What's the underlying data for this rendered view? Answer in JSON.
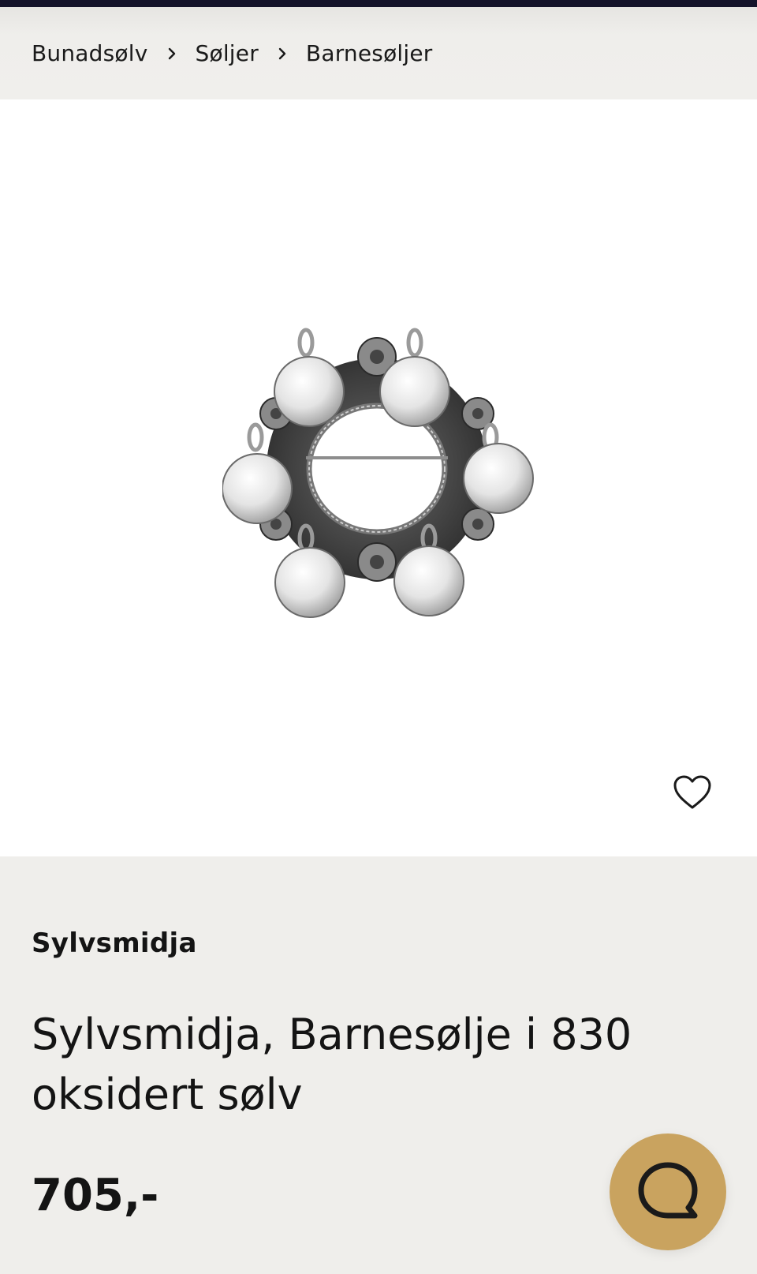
{
  "breadcrumb": {
    "items": [
      {
        "label": "Bunadsølv"
      },
      {
        "label": "Søljer"
      },
      {
        "label": "Barnesøljer"
      }
    ],
    "separator_icon": "chevron-right-icon"
  },
  "product": {
    "image_icon": "brooch-product-image",
    "favorite_icon": "heart-outline-icon",
    "brand": "Sylvsmidja",
    "title_line1": "Sylvsmidja, Barnesølje i 830",
    "title_line2": "oksidert sølv",
    "price": "705,-"
  },
  "chat": {
    "icon": "chat-bubble-icon",
    "color": "#c9a35f"
  },
  "colors": {
    "topbar": "#14142a",
    "background": "#efeeeb",
    "image_background": "#ffffff"
  }
}
